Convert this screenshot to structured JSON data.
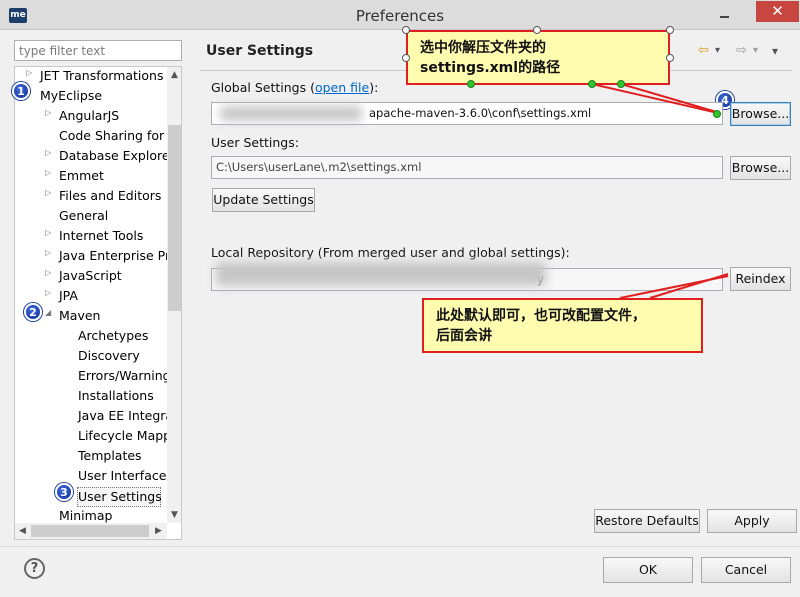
{
  "window": {
    "title": "Preferences",
    "app_icon": "me",
    "close_glyph": "✕"
  },
  "filter": {
    "placeholder": "type filter text"
  },
  "tree": {
    "items": [
      {
        "label": "JET Transformations",
        "twisty": "▷"
      },
      {
        "label": "MyEclipse",
        "twisty": ""
      },
      {
        "label": "AngularJS",
        "twisty": "▷"
      },
      {
        "label": "Code Sharing for S",
        "twisty": ""
      },
      {
        "label": "Database Explorer",
        "twisty": "▷"
      },
      {
        "label": "Emmet",
        "twisty": "▷"
      },
      {
        "label": "Files and Editors",
        "twisty": "▷"
      },
      {
        "label": "General",
        "twisty": ""
      },
      {
        "label": "Internet Tools",
        "twisty": "▷"
      },
      {
        "label": "Java Enterprise Pr",
        "twisty": "▷"
      },
      {
        "label": "JavaScript",
        "twisty": "▷"
      },
      {
        "label": "JPA",
        "twisty": "▷"
      },
      {
        "label": "Maven",
        "twisty": "◢"
      },
      {
        "label": "Archetypes",
        "twisty": ""
      },
      {
        "label": "Discovery",
        "twisty": ""
      },
      {
        "label": "Errors/Warning",
        "twisty": ""
      },
      {
        "label": "Installations",
        "twisty": ""
      },
      {
        "label": "Java EE Integra",
        "twisty": ""
      },
      {
        "label": "Lifecycle Mapp",
        "twisty": ""
      },
      {
        "label": "Templates",
        "twisty": ""
      },
      {
        "label": "User Interface",
        "twisty": ""
      },
      {
        "label": "User Settings",
        "twisty": ""
      },
      {
        "label": "Minimap",
        "twisty": ""
      }
    ],
    "selected": "User Settings",
    "scroll_up": "▲",
    "scroll_down": "▼",
    "scroll_left": "◀",
    "scroll_right": "▶"
  },
  "badges": [
    "1",
    "2",
    "3",
    "4"
  ],
  "page": {
    "title": "User Settings",
    "nav": {
      "back": "⇦",
      "back_menu": "▾",
      "forward": "⇨",
      "forward_menu": "▾",
      "view_menu": "▾"
    },
    "global_settings_label": "Global Settings (",
    "open_file_link": "open file",
    "global_settings_label_end": "):",
    "global_settings_value": "apache-maven-3.6.0\\conf\\settings.xml",
    "user_settings_label": "User Settings:",
    "user_settings_value": "C:\\Users\\userLane\\.m2\\settings.xml",
    "local_repo_label": "Local Repository (From merged user and global settings):",
    "local_repo_value": "y",
    "browse_label": "Browse...",
    "update_settings_label": "Update Settings",
    "reindex_label": "Reindex",
    "restore_defaults_label": "Restore Defaults",
    "apply_label": "Apply"
  },
  "callouts": {
    "top": [
      "选中你解压文件夹的",
      "settings.xml的路径"
    ],
    "middle": [
      "此处默认即可，也可改配置文件，",
      "后面会讲"
    ]
  },
  "footer": {
    "ok_label": "OK",
    "cancel_label": "Cancel",
    "help_glyph": "?"
  }
}
